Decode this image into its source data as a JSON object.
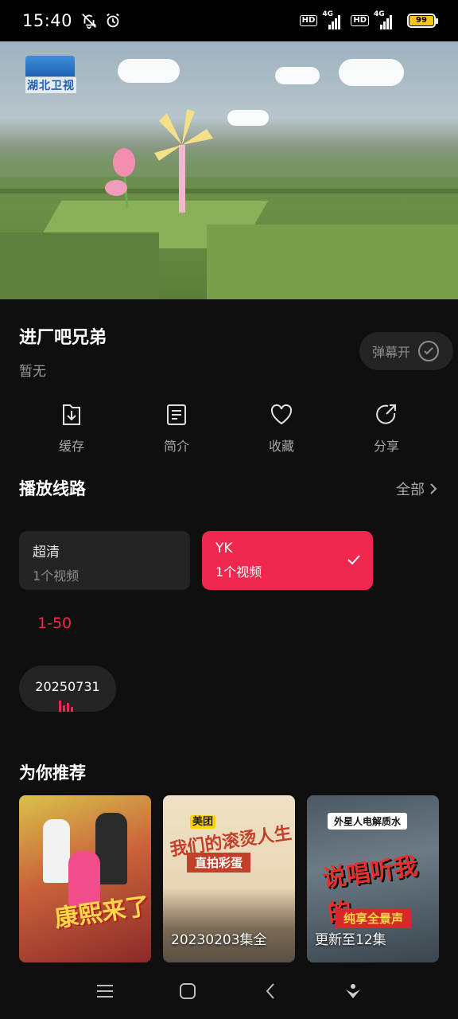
{
  "status_bar": {
    "time": "15:40",
    "left_icons": [
      "mute-bell-icon",
      "alarm-icon"
    ],
    "hd_label": "HD",
    "network_label": "4G",
    "battery_level": "99",
    "battery_color": "#f5c518"
  },
  "video": {
    "channel_logo_text": "湖北卫视"
  },
  "show": {
    "title": "进厂吧兄弟",
    "subtitle": "暂无",
    "danmaku_label": "弹幕开"
  },
  "actions": [
    {
      "label": "缓存",
      "icon": "download-icon"
    },
    {
      "label": "简介",
      "icon": "document-icon"
    },
    {
      "label": "收藏",
      "icon": "heart-icon"
    },
    {
      "label": "分享",
      "icon": "share-icon"
    }
  ],
  "routes_section": {
    "title": "播放线路",
    "see_all": "全部",
    "routes": [
      {
        "name": "超清",
        "count": "1个视频",
        "selected": false
      },
      {
        "name": "YK",
        "count": "1个视频",
        "selected": true
      }
    ]
  },
  "range_tab": "1-50",
  "episodes": [
    "20250731"
  ],
  "recommend": {
    "title": "为你推荐",
    "items": [
      {
        "poster_text": "康熙来了",
        "caption": ""
      },
      {
        "poster_text": "我们的滚烫人生",
        "poster_tag": "直拍彩蛋",
        "brand": "美团",
        "caption": "20230203集全"
      },
      {
        "poster_text": "说唱听我的",
        "poster_tag": "纯享全景声",
        "brand": "外星人电解质水",
        "caption": "更新至12集"
      }
    ]
  },
  "colors": {
    "accent": "#f0274f",
    "background": "#0f0f10",
    "card": "#242424",
    "muted_text": "#9a9a9a"
  }
}
